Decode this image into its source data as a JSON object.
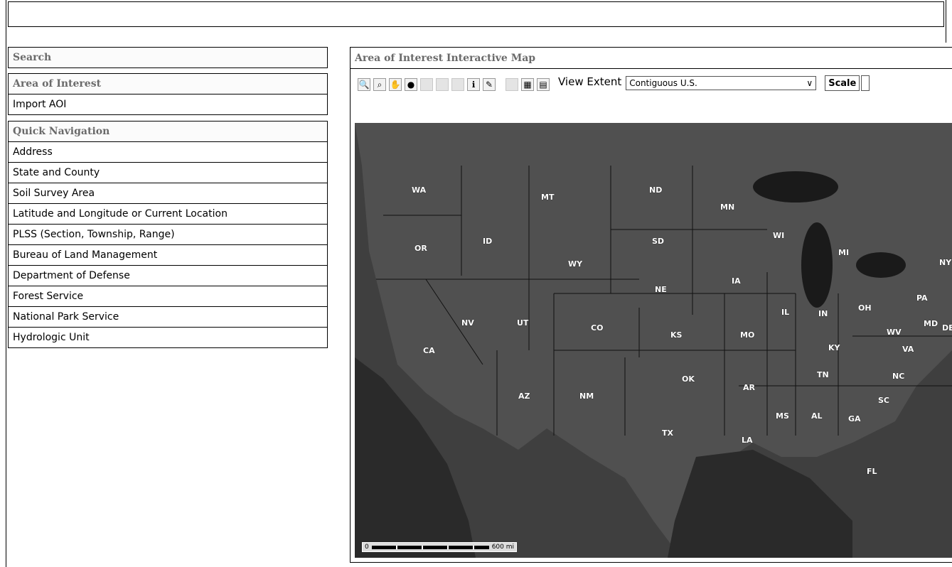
{
  "left_panel": {
    "search_header": "Search",
    "aoi_header": "Area of Interest",
    "aoi_items": [
      "Import AOI"
    ],
    "nav_header": "Quick Navigation",
    "nav_items": [
      "Address",
      "State and County",
      "Soil Survey Area",
      "Latitude and Longitude or Current Location",
      "PLSS (Section, Township, Range)",
      "Bureau of Land Management",
      "Department of Defense",
      "Forest Service",
      "National Park Service",
      "Hydrologic Unit"
    ]
  },
  "map_panel": {
    "title": "Area of Interest Interactive Map",
    "toolbar": {
      "tools": [
        "zoom-in-icon",
        "zoom-out-icon",
        "pan-hand-icon",
        "globe-icon",
        "blank-tool-icon",
        "blank-tool-icon",
        "blank-tool-icon",
        "identify-info-icon",
        "measure-pencil-icon",
        "blank-tool-icon",
        "blank-tool-icon",
        "grid-tool-icon"
      ],
      "view_extent_label": "View Extent",
      "view_extent_value": "Contiguous U.S.",
      "scale_label": "Scale"
    },
    "state_labels": [
      "WA",
      "MT",
      "ND",
      "MN",
      "OR",
      "ID",
      "SD",
      "WI",
      "MI",
      "NY",
      "WY",
      "IA",
      "NE",
      "PA",
      "NV",
      "UT",
      "CO",
      "IL",
      "IN",
      "OH",
      "MD",
      "DE",
      "CA",
      "KS",
      "MO",
      "KY",
      "WV",
      "VA",
      "TN",
      "NC",
      "OK",
      "AR",
      "AZ",
      "NM",
      "SC",
      "TX",
      "MS",
      "AL",
      "GA",
      "LA",
      "FL"
    ],
    "scale_bar_text": "600 mi"
  },
  "colors": {
    "map_land": "#4a4a4a",
    "water": "#222222",
    "header_text": "#6a6a6a"
  }
}
